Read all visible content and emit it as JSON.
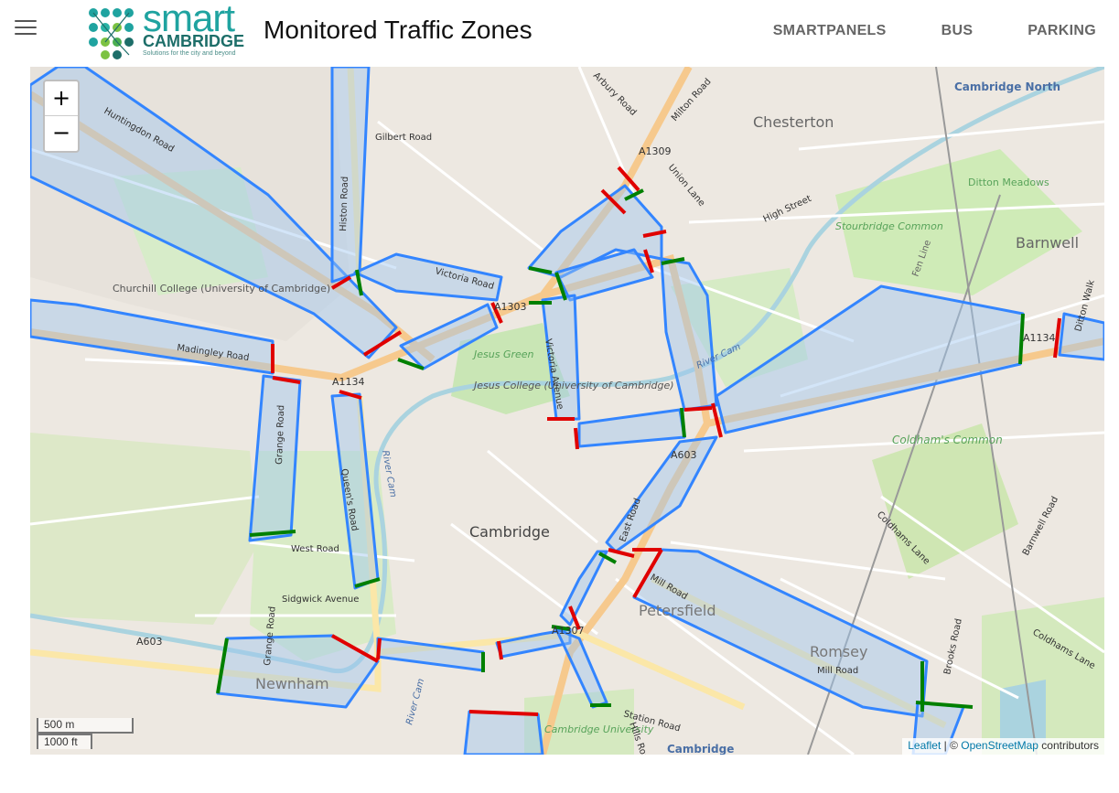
{
  "header": {
    "menu_icon": "hamburger-icon",
    "logo": {
      "word1": "smart",
      "word2": "CAMBRIDGE",
      "tagline": "Solutions for the city and beyond"
    },
    "title": "Monitored Traffic Zones",
    "nav": [
      "SMARTPANELS",
      "BUS",
      "PARKING"
    ]
  },
  "map": {
    "zoom_in": "+",
    "zoom_out": "−",
    "scale_metric": "500 m",
    "scale_imperial": "1000 ft",
    "attribution": {
      "leaflet": "Leaflet",
      "sep": " | © ",
      "osm": "OpenStreetMap",
      "suffix": " contributors"
    },
    "place_labels": [
      "Cambridge North",
      "Chesterton",
      "Ditton Meadows",
      "Barnwell",
      "Stourbridge Common",
      "Churchill College (University of Cambridge)",
      "Jesus Green",
      "Jesus College (University of Cambridge)",
      "Coldham's Common",
      "Cambridge",
      "Petersfield",
      "Romsey",
      "Newnham",
      "Cambridge University",
      "Cambridge"
    ],
    "road_labels": [
      "Huntingdon Road",
      "Histon Road",
      "Gilbert Road",
      "Arbury Road",
      "Milton Road",
      "A1309",
      "Union Lane",
      "High Street",
      "Victoria Road",
      "A1303",
      "Victoria Avenue",
      "Madingley Road",
      "A1134",
      "Grange Road",
      "Queen's Road",
      "River Cam",
      "East Road",
      "A603",
      "West Road",
      "Sidgwick Avenue",
      "A603",
      "Grange Road",
      "Mill Road",
      "Mill Road",
      "Coldhams Lane",
      "Barnwell Road",
      "Brooks Road",
      "Coldhams Lane",
      "Station Road",
      "Hills Road",
      "A1307",
      "A1134",
      "Fen Line",
      "River Cam",
      "River Cam",
      "Ditton Walk"
    ],
    "zone_color": "#3385ff",
    "zone_fill": "#9ec5f0",
    "boundary_in": "#008000",
    "boundary_out": "#e00000"
  }
}
